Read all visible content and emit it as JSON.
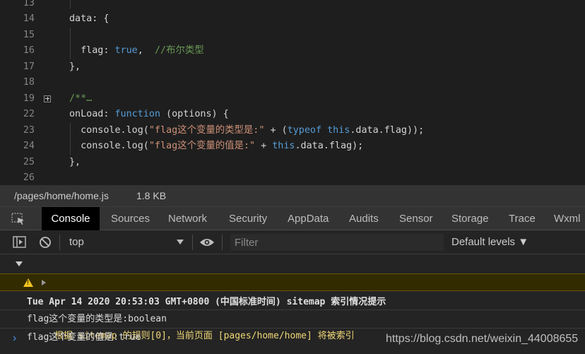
{
  "editor": {
    "lines": [
      {
        "n": "13"
      },
      {
        "n": "14",
        "code": [
          {
            "t": "data: {",
            "c": "tk-plain"
          }
        ]
      },
      {
        "n": "15"
      },
      {
        "n": "16",
        "code": [
          {
            "t": "  flag",
            "c": "tk-plain"
          },
          {
            "t": ": ",
            "c": "tk-plain"
          },
          {
            "t": "true",
            "c": "tk-bool"
          },
          {
            "t": ",  ",
            "c": "tk-plain"
          },
          {
            "t": "//布尔类型",
            "c": "tk-com"
          }
        ]
      },
      {
        "n": "17",
        "code": [
          {
            "t": "},",
            "c": "tk-plain"
          }
        ]
      },
      {
        "n": "18"
      },
      {
        "n": "19",
        "fold": true,
        "code": [
          {
            "t": "/**…",
            "c": "tk-com"
          }
        ]
      },
      {
        "n": "22",
        "code": [
          {
            "t": "onLoad",
            "c": "tk-plain"
          },
          {
            "t": ": ",
            "c": "tk-plain"
          },
          {
            "t": "function",
            "c": "tk-kw"
          },
          {
            "t": " (options) {",
            "c": "tk-plain"
          }
        ]
      },
      {
        "n": "23",
        "code": [
          {
            "t": "  console.log(",
            "c": "tk-plain"
          },
          {
            "t": "\"flag这个变量的类型是:\"",
            "c": "tk-str"
          },
          {
            "t": " + (",
            "c": "tk-plain"
          },
          {
            "t": "typeof",
            "c": "tk-kw"
          },
          {
            "t": " ",
            "c": "tk-plain"
          },
          {
            "t": "this",
            "c": "tk-kw"
          },
          {
            "t": ".data.flag));",
            "c": "tk-plain"
          }
        ]
      },
      {
        "n": "24",
        "code": [
          {
            "t": "  console.log(",
            "c": "tk-plain"
          },
          {
            "t": "\"flag这个变量的值是:\"",
            "c": "tk-str"
          },
          {
            "t": " + ",
            "c": "tk-plain"
          },
          {
            "t": "this",
            "c": "tk-kw"
          },
          {
            "t": ".data.flag);",
            "c": "tk-plain"
          }
        ]
      },
      {
        "n": "25",
        "code": [
          {
            "t": "},",
            "c": "tk-plain"
          }
        ]
      },
      {
        "n": "26"
      }
    ]
  },
  "status": {
    "path": "/pages/home/home.js",
    "size": "1.8 KB"
  },
  "devtools": {
    "tabs": [
      "Console",
      "Sources",
      "Network",
      "Security",
      "AppData",
      "Audits",
      "Sensor",
      "Storage",
      "Trace",
      "Wxml"
    ],
    "active_tab": "Console"
  },
  "toolbar": {
    "context": "top",
    "filter_placeholder": "Filter",
    "levels": "Default levels ▼"
  },
  "console": {
    "group_title": "Tue Apr 14 2020 20:53:03 GMT+0800 (中国标准时间) sitemap 索引情况提示",
    "warning": "根据 sitemap 的规则[0]，当前页面 [pages/home/home] 将被索引",
    "logs": [
      "flag这个变量的类型是:boolean",
      "flag这个变量的值是:true"
    ],
    "prompt": "›"
  },
  "watermark": "https://blog.csdn.net/weixin_44008655",
  "colors": {
    "active_tab_bg": "#000000",
    "warning_bg": "#332b00",
    "warning_text": "#f0d776",
    "accent_blue": "#4a8fe7"
  }
}
